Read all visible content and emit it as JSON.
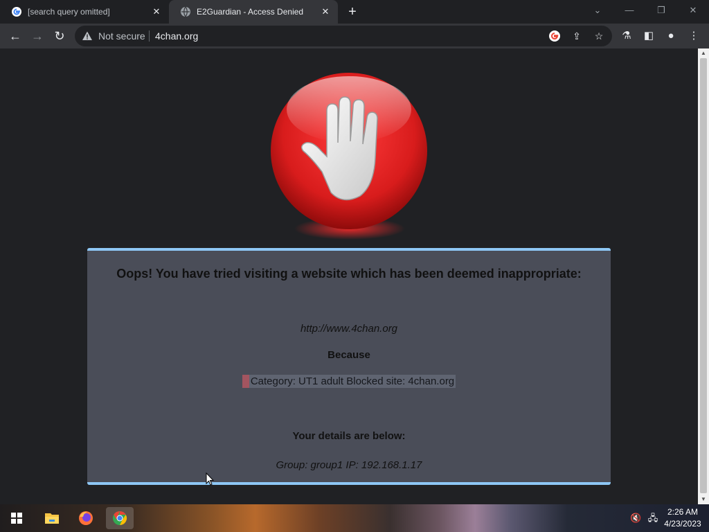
{
  "browser": {
    "tabs": [
      {
        "title": "[search query omitted]",
        "favicon": "google-g-icon",
        "active": false
      },
      {
        "title": "E2Guardian - Access Denied",
        "favicon": "globe-icon",
        "active": true
      }
    ],
    "close_glyph": "✕",
    "new_tab_glyph": "+",
    "address": {
      "security_label": "Not secure",
      "url": "4chan.org"
    },
    "icons": [
      "back-icon",
      "forward-icon",
      "reload-icon",
      "google-lens-icon",
      "share-icon",
      "bookmark-star-icon",
      "extensions-icon",
      "side-panel-icon",
      "profile-icon",
      "menu-icon"
    ]
  },
  "page": {
    "heading": "Oops! You have tried visiting a website which has been deemed inappropriate:",
    "blocked_url": "http://www.4chan.org",
    "because_label": "Because",
    "reason": "Category: UT1 adult   Blocked site: 4chan.org",
    "details_heading": "Your details are below:",
    "details": "Group: group1   IP: 192.168.1.17",
    "colors": {
      "panel": "#4a4d58",
      "panel_border": "#8ec7f5",
      "stop_red": "#d81c1c"
    }
  },
  "taskbar": {
    "apps": [
      "start-icon",
      "file-explorer-icon",
      "firefox-icon",
      "chrome-icon"
    ],
    "tray": [
      "volume-muted-icon",
      "network-icon"
    ],
    "time": "2:26 AM",
    "date": "4/23/2023"
  }
}
